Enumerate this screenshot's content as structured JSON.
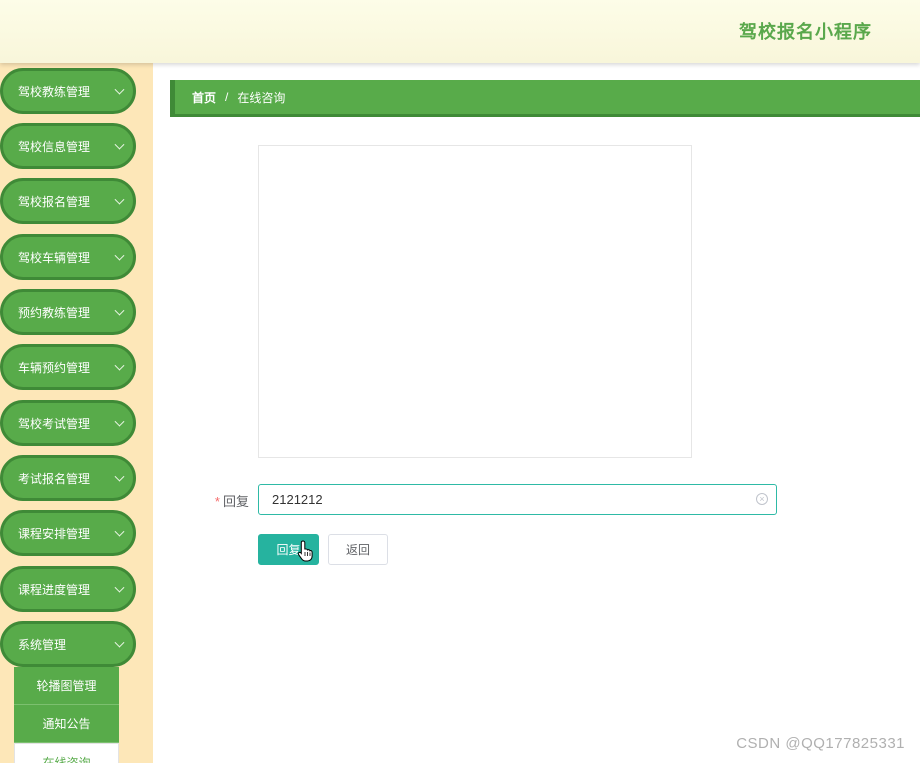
{
  "header": {
    "app_title": "驾校报名小程序"
  },
  "sidebar": {
    "items": [
      {
        "label": "驾校教练管理"
      },
      {
        "label": "驾校信息管理"
      },
      {
        "label": "驾校报名管理"
      },
      {
        "label": "驾校车辆管理"
      },
      {
        "label": "预约教练管理"
      },
      {
        "label": "车辆预约管理"
      },
      {
        "label": "驾校考试管理"
      },
      {
        "label": "考试报名管理"
      },
      {
        "label": "课程安排管理"
      },
      {
        "label": "课程进度管理"
      },
      {
        "label": "系统管理"
      }
    ],
    "submenu": [
      {
        "label": "轮播图管理"
      },
      {
        "label": "通知公告"
      },
      {
        "label": "在线咨询"
      }
    ]
  },
  "breadcrumb": {
    "home": "首页",
    "separator": "/",
    "current": "在线咨询"
  },
  "form": {
    "reply_label": "回复",
    "required_mark": "*",
    "reply_value": "2121212",
    "clear_glyph": "×",
    "submit_label": "回复",
    "back_label": "返回"
  },
  "watermark": "CSDN @QQ177825331",
  "colors": {
    "primary": "#58ab4a",
    "accent": "#26b39f",
    "sidebar_bg": "#fde7b8"
  }
}
